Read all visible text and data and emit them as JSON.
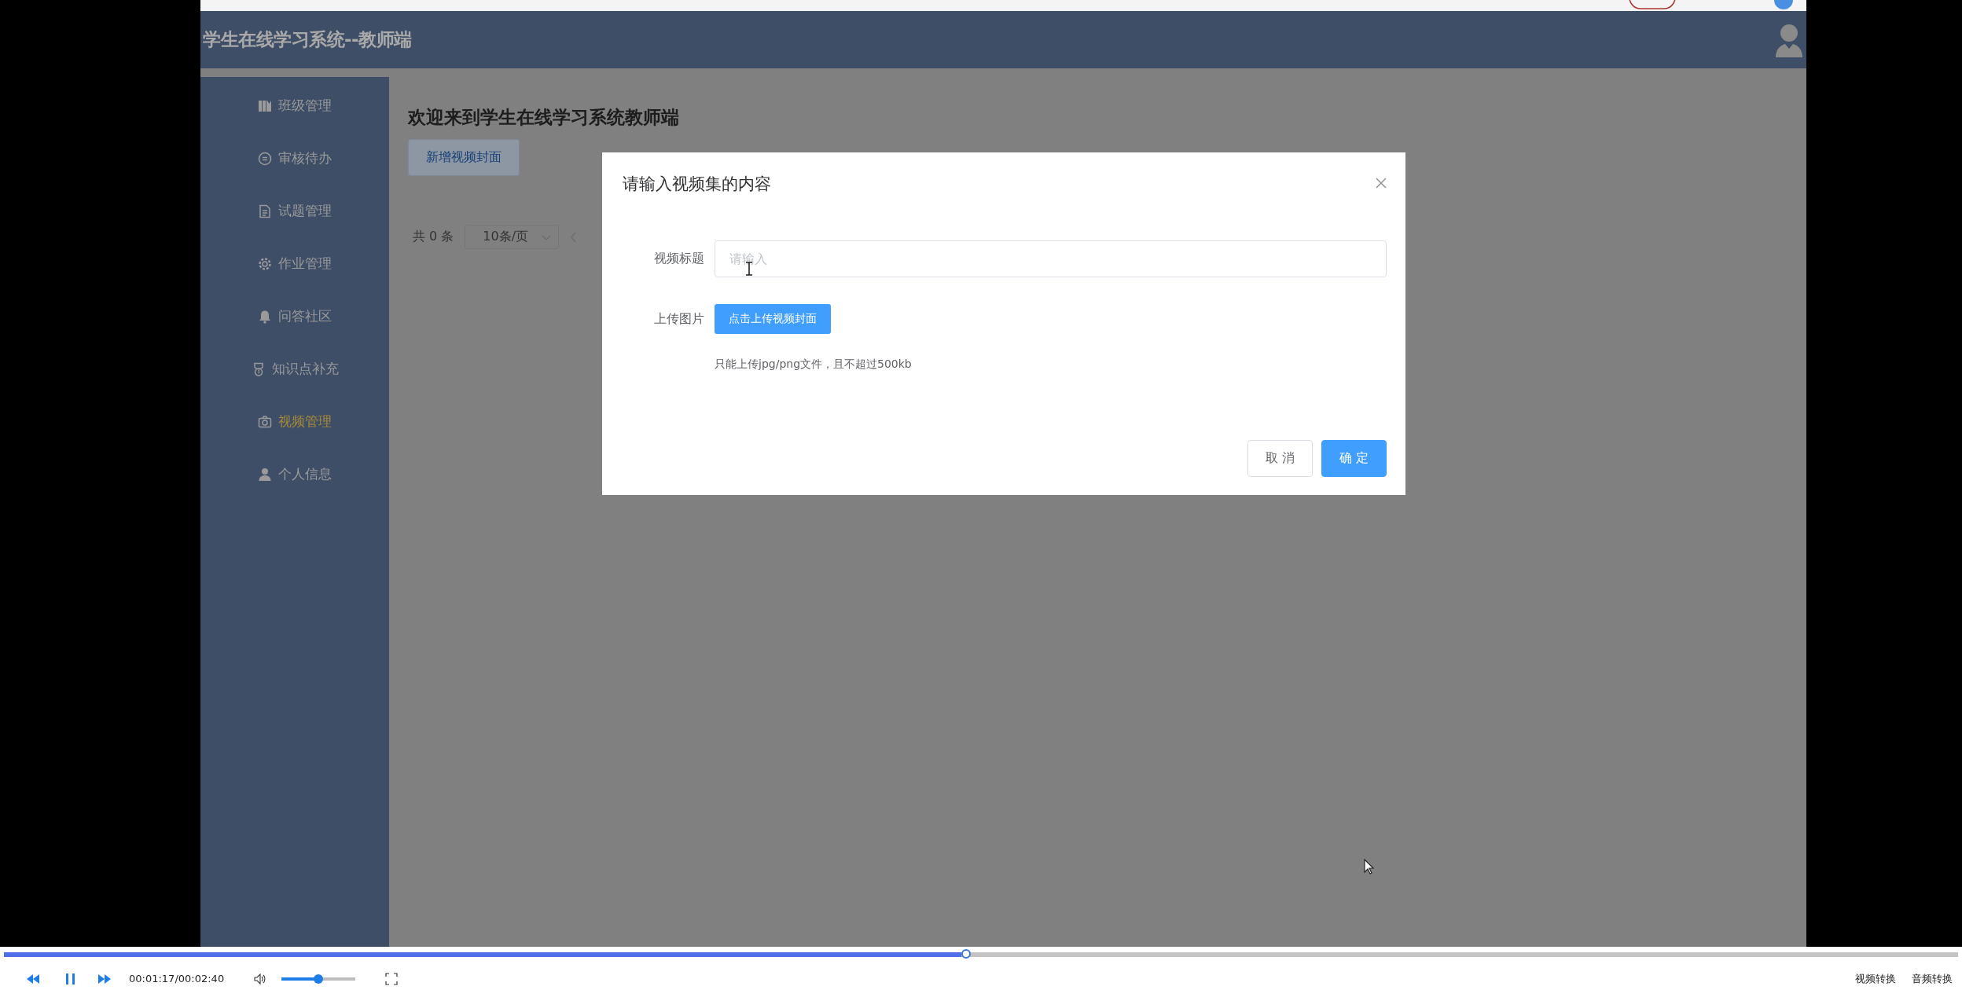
{
  "header": {
    "title": "学生在线学习系统--教师端"
  },
  "sidebar": {
    "items": [
      {
        "label": "班级管理",
        "selected": false
      },
      {
        "label": "审核待办",
        "selected": false
      },
      {
        "label": "试题管理",
        "selected": false
      },
      {
        "label": "作业管理",
        "selected": false
      },
      {
        "label": "问答社区",
        "selected": false
      },
      {
        "label": "知识点补充",
        "selected": false
      },
      {
        "label": "视频管理",
        "selected": true
      },
      {
        "label": "个人信息",
        "selected": false
      }
    ]
  },
  "main": {
    "title": "欢迎来到学生在线学习系统教师端",
    "add_button": "新增视频封面",
    "pagination": {
      "total": "共 0 条",
      "page_size": "10条/页"
    }
  },
  "dialog": {
    "title": "请输入视频集的内容",
    "fields": [
      {
        "kind": "input",
        "label": "视频标题",
        "placeholder": "请输入"
      },
      {
        "kind": "upload",
        "label": "上传图片",
        "button": "点击上传视频封面",
        "hint": "只能上传jpg/png文件，且不超过500kb"
      }
    ],
    "buttons": [
      {
        "kind": "default",
        "label": "取 消"
      },
      {
        "kind": "primary",
        "label": "确 定"
      }
    ]
  },
  "player": {
    "progress": {
      "level": 0.49
    },
    "time": "00:01:17/00:02:40",
    "volume": {
      "level": 0.5
    },
    "links": [
      "视频转换",
      "音频转换"
    ]
  }
}
